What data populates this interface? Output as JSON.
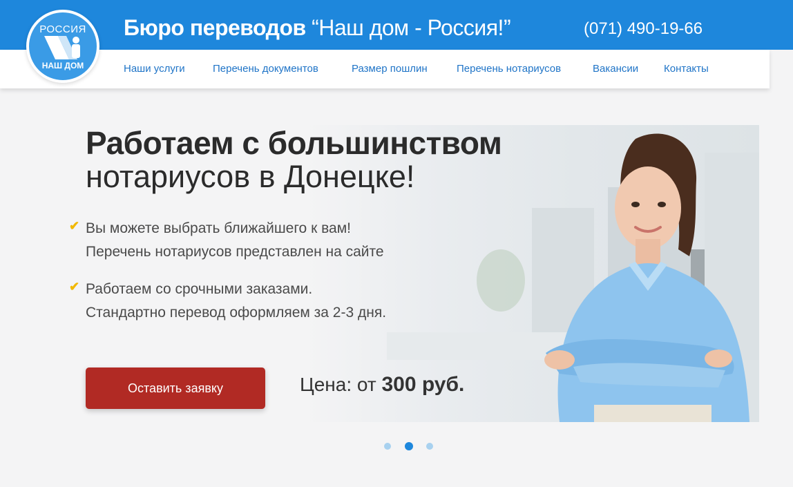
{
  "header": {
    "logo": {
      "top_text": "РОССИЯ",
      "bottom_text": "НАШ ДОМ"
    },
    "title_bold": "Бюро переводов",
    "title_rest": " “Наш дом - Россия!”",
    "phone": "(071) 490-19-66",
    "bar_color": "#1e87dc"
  },
  "nav": {
    "items": [
      {
        "label": "Наши услуги"
      },
      {
        "label": "Перечень документов"
      },
      {
        "label": "Размер пошлин"
      },
      {
        "label": "Перечень нотариусов"
      },
      {
        "label": "Вакансии"
      },
      {
        "label": "Контакты"
      }
    ]
  },
  "hero": {
    "headline_bold": "Работаем с большинством",
    "headline_regular": "нотариусов в Донецке!",
    "bullets": [
      {
        "icon": "check-icon",
        "line1": "Вы можете выбрать ближайшего к вам!",
        "line2": "Перечень нотариусов представлен на сайте"
      },
      {
        "icon": "check-icon",
        "line1": "Работаем со срочными заказами.",
        "line2": "Стандартно перевод оформляем за 2-3 дня."
      }
    ],
    "cta_label": "Оставить заявку",
    "cta_color": "#b12a24",
    "price_prefix": "Цена: от ",
    "price_amount": "300 руб."
  },
  "slider": {
    "count": 3,
    "active": 2
  }
}
